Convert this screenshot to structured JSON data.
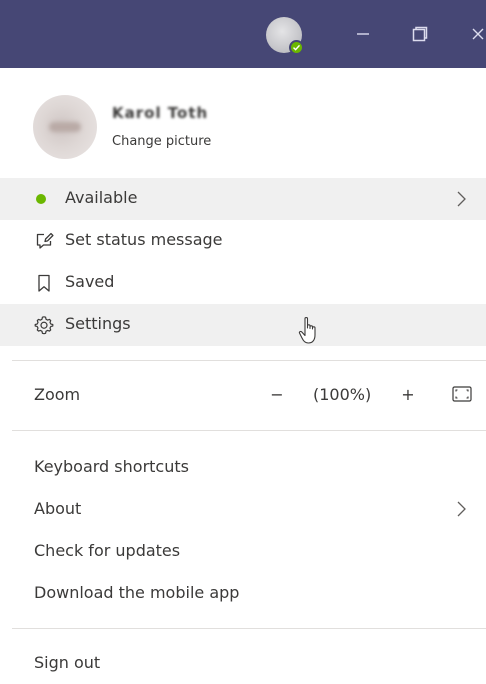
{
  "titlebar": {
    "avatar_icon": "user-avatar",
    "presence_color": "#6bb700",
    "background": "#464775",
    "window_controls": [
      "minimize-icon",
      "restore-icon",
      "close-icon"
    ]
  },
  "profile": {
    "name": "Karol Toth",
    "change_picture": "Change picture"
  },
  "status_menu": {
    "available": "Available",
    "set_status": "Set status message",
    "saved": "Saved",
    "settings": "Settings"
  },
  "zoom": {
    "label": "Zoom",
    "minus": "−",
    "value": "(100%)",
    "plus": "+"
  },
  "menu": {
    "keyboard_shortcuts": "Keyboard shortcuts",
    "about": "About",
    "check_updates": "Check for updates",
    "download_mobile": "Download the mobile app",
    "sign_out": "Sign out"
  }
}
